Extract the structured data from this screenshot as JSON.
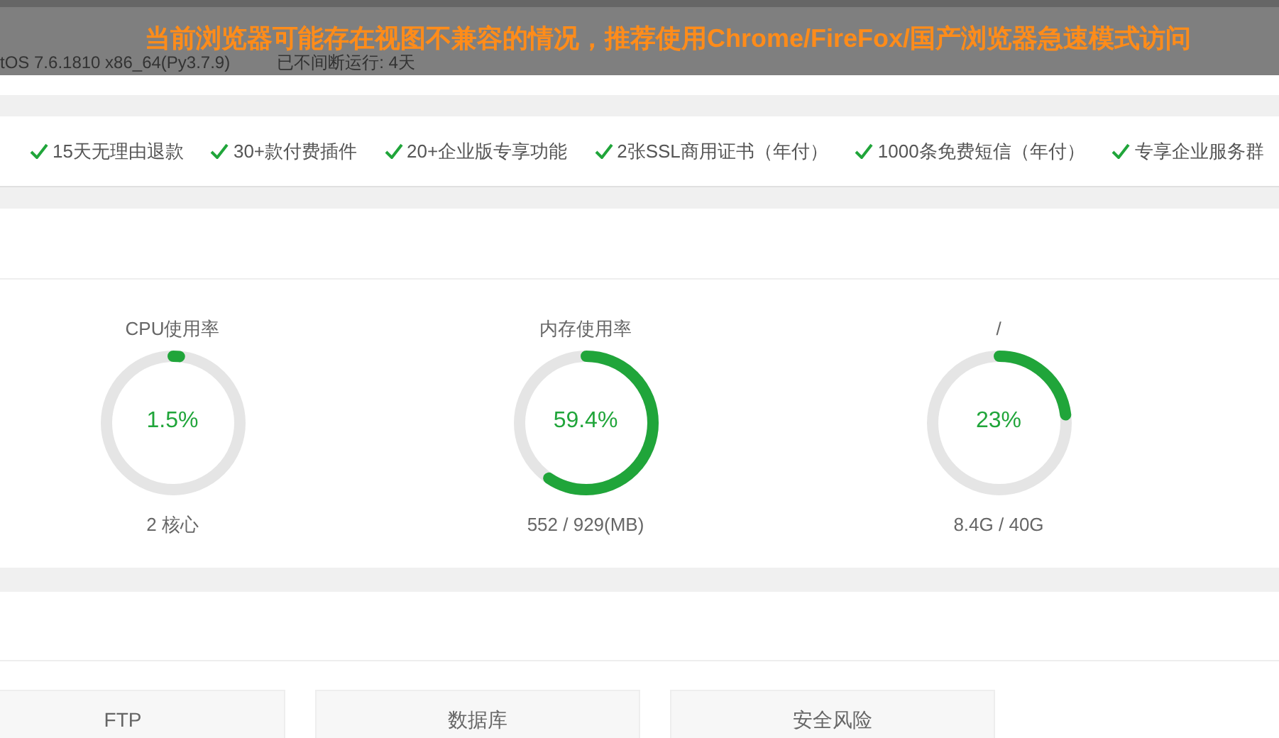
{
  "warning_banner": "当前浏览器可能存在视图不兼容的情况，推荐使用Chrome/FireFox/国产浏览器急速模式访问",
  "system_bar": {
    "os": "tOS 7.6.1810 x86_64(Py3.7.9)",
    "uptime": "已不间断运行: 4天"
  },
  "features": [
    "15天无理由退款",
    "30+款付费插件",
    "20+企业版专享功能",
    "2张SSL商用证书（年付）",
    "1000条免费短信（年付）",
    "专享企业服务群"
  ],
  "gauges": [
    {
      "title": "CPU使用率",
      "value": "1.5%",
      "level": 0.015,
      "detail": "2 核心"
    },
    {
      "title": "内存使用率",
      "value": "59.4%",
      "level": 0.594,
      "detail": "552 / 929(MB)"
    },
    {
      "title": "/",
      "value": "23%",
      "level": 0.23,
      "detail": "8.4G / 40G"
    }
  ],
  "cards": [
    {
      "title": "FTP"
    },
    {
      "title": "数据库"
    },
    {
      "title": "安全风险"
    }
  ]
}
